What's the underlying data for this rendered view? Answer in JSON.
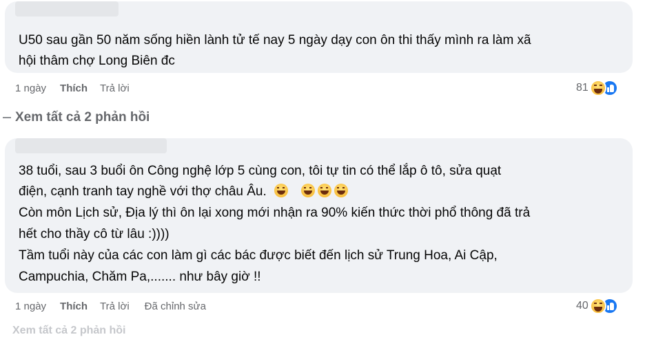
{
  "comments": [
    {
      "lines": [
        "U50 sau gần 50 năm sống hiền lành tử tế nay 5 ngày dạy con ôn thi thấy mình ra làm xã",
        "hội thâm chợ Long Biên đc"
      ],
      "time": "1 ngày",
      "like_label": "Thích",
      "reply_label": "Trả lời",
      "reaction_count": "81",
      "reaction_icons": [
        "haha-icon",
        "like-icon"
      ]
    },
    {
      "line1": "38 tuổi, sau 3 buổi ôn Công nghệ lớp 5 cùng con, tôi tự tin có thể lắp ô tô, sửa quạt",
      "line2": "điện, cạnh tranh tay nghề với thợ châu Âu.",
      "line3": "Còn môn Lịch sử, Địa lý thì ôn lại xong mới nhận ra 90% kiến thức thời phổ thông đã trả",
      "line4": "hết cho thầy cô từ lâu :))))",
      "line5": "Tầm tuổi này của các con làm gì các bác được biết đến lịch sử Trung Hoa, Ai Cập,",
      "line6": "Campuchia, Chăm Pa,....... như bây giờ !!",
      "time": "1 ngày",
      "like_label": "Thích",
      "reply_label": "Trả lời",
      "edited_label": "Đã chỉnh sửa",
      "reaction_count": "40",
      "reaction_icons": [
        "haha-icon",
        "like-icon"
      ]
    }
  ],
  "view_replies_label": "Xem tất cả 2 phản hồi",
  "bottom_partial_label": "Xem tất cả 2 phản hồi"
}
